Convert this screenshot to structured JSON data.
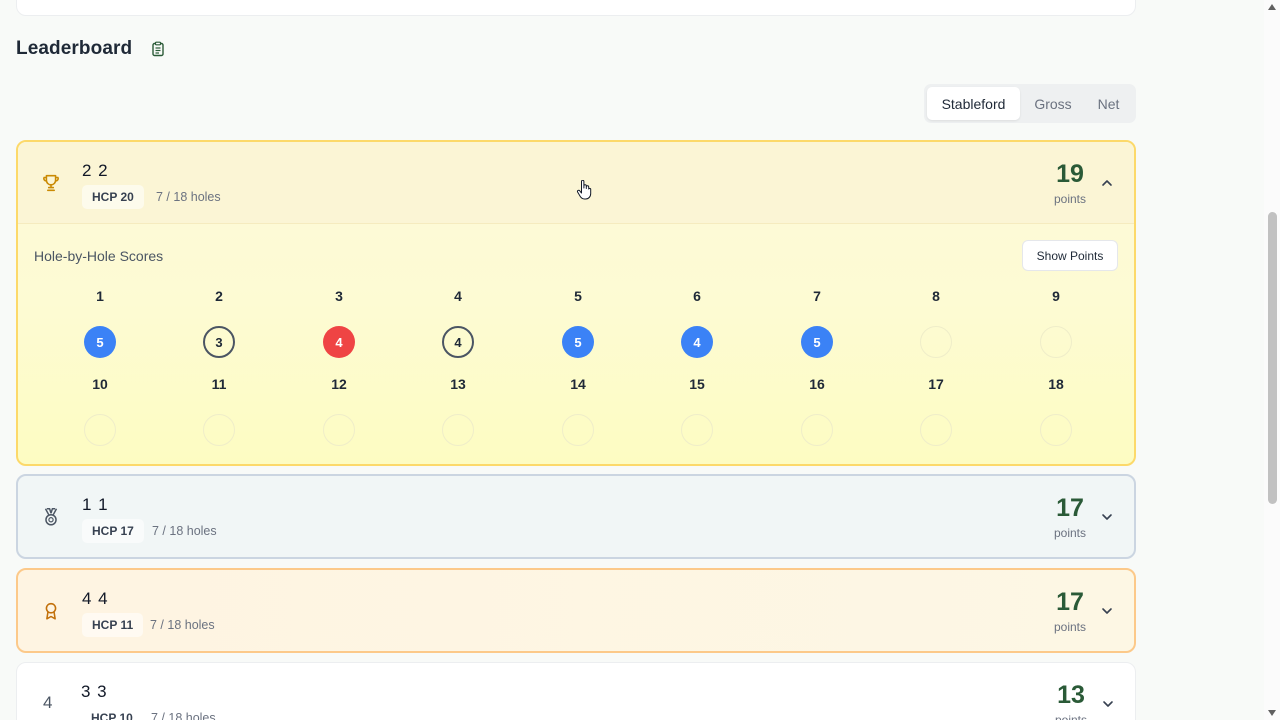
{
  "header": {
    "title": "Leaderboard",
    "icon": "clipboard-icon"
  },
  "tabs": [
    {
      "label": "Stableford",
      "active": true
    },
    {
      "label": "Gross",
      "active": false
    },
    {
      "label": "Net",
      "active": false
    }
  ],
  "colors": {
    "accent": "#2a5a37",
    "birdie": "#3b82f6",
    "bogey": "#ef4444"
  },
  "players": [
    {
      "rank_icon": "trophy-icon",
      "name": "2 2",
      "hcp": "HCP 20",
      "holes": "7 / 18 holes",
      "score": "19",
      "unit": "points",
      "expanded": true
    },
    {
      "rank_icon": "medal-icon",
      "name": "1 1",
      "hcp": "HCP 17",
      "holes": "7 / 18 holes",
      "score": "17",
      "unit": "points",
      "expanded": false
    },
    {
      "rank_icon": "award-icon",
      "name": "4 4",
      "hcp": "HCP 11",
      "holes": "7 / 18 holes",
      "score": "17",
      "unit": "points",
      "expanded": false
    },
    {
      "rank": "4",
      "name": "3 3",
      "hcp": "HCP 10",
      "holes": "7 / 18 holes",
      "score": "13",
      "unit": "points",
      "expanded": false
    }
  ],
  "detail": {
    "title": "Hole-by-Hole Scores",
    "show_points_label": "Show Points",
    "holes": [
      {
        "hole": "1",
        "score": "5",
        "style": "blue"
      },
      {
        "hole": "2",
        "score": "3",
        "style": "ring"
      },
      {
        "hole": "3",
        "score": "4",
        "style": "red"
      },
      {
        "hole": "4",
        "score": "4",
        "style": "ring"
      },
      {
        "hole": "5",
        "score": "5",
        "style": "blue"
      },
      {
        "hole": "6",
        "score": "4",
        "style": "blue"
      },
      {
        "hole": "7",
        "score": "5",
        "style": "blue"
      },
      {
        "hole": "8",
        "score": "",
        "style": "empty"
      },
      {
        "hole": "9",
        "score": "",
        "style": "empty"
      },
      {
        "hole": "10",
        "score": "",
        "style": "empty"
      },
      {
        "hole": "11",
        "score": "",
        "style": "empty"
      },
      {
        "hole": "12",
        "score": "",
        "style": "empty"
      },
      {
        "hole": "13",
        "score": "",
        "style": "empty"
      },
      {
        "hole": "14",
        "score": "",
        "style": "empty"
      },
      {
        "hole": "15",
        "score": "",
        "style": "empty"
      },
      {
        "hole": "16",
        "score": "",
        "style": "empty"
      },
      {
        "hole": "17",
        "score": "",
        "style": "empty"
      },
      {
        "hole": "18",
        "score": "",
        "style": "empty"
      }
    ]
  }
}
